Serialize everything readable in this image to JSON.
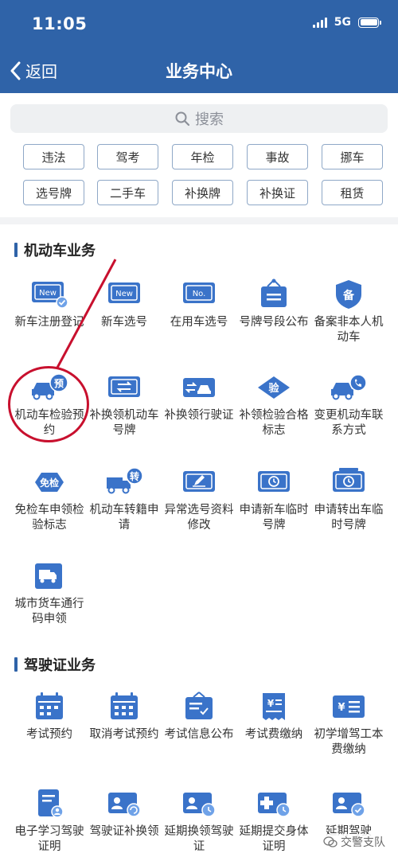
{
  "status_bar": {
    "time": "11:05",
    "network": "5G"
  },
  "nav": {
    "back_label": "返回",
    "title": "业务中心"
  },
  "search": {
    "placeholder": "搜索"
  },
  "tags": [
    "违法",
    "驾考",
    "年检",
    "事故",
    "挪车",
    "选号牌",
    "二手车",
    "补换牌",
    "补换证",
    "租赁"
  ],
  "vehicle_section": {
    "title": "机动车业务",
    "items": [
      {
        "label": "新车注册登记",
        "icon": "new-plate-check-icon"
      },
      {
        "label": "新车选号",
        "icon": "new-plate-icon"
      },
      {
        "label": "在用车选号",
        "icon": "number-plate-icon"
      },
      {
        "label": "号牌号段公布",
        "icon": "hanging-sign-icon"
      },
      {
        "label": "备案非本人机动车",
        "icon": "shield-record-icon"
      },
      {
        "label": "机动车检验预约",
        "icon": "car-reserve-icon"
      },
      {
        "label": "补换领机动车号牌",
        "icon": "plate-swap-icon"
      },
      {
        "label": "补换领行驶证",
        "icon": "license-swap-icon"
      },
      {
        "label": "补领检验合格标志",
        "icon": "inspection-badge-icon"
      },
      {
        "label": "变更机动车联系方式",
        "icon": "car-phone-icon"
      },
      {
        "label": "免检车申领检验标志",
        "icon": "exempt-badge-icon"
      },
      {
        "label": "机动车转籍申请",
        "icon": "transfer-truck-icon"
      },
      {
        "label": "异常选号资料修改",
        "icon": "edit-plate-icon"
      },
      {
        "label": "申请新车临时号牌",
        "icon": "temp-plate-icon"
      },
      {
        "label": "申请转出车临时号牌",
        "icon": "temp-plate-out-icon"
      },
      {
        "label": "城市货车通行码申领",
        "icon": "truck-pass-icon"
      }
    ]
  },
  "license_section": {
    "title": "驾驶证业务",
    "items": [
      {
        "label": "考试预约",
        "icon": "calendar-icon"
      },
      {
        "label": "取消考试预约",
        "icon": "calendar-cancel-icon"
      },
      {
        "label": "考试信息公布",
        "icon": "info-board-icon"
      },
      {
        "label": "考试费缴纳",
        "icon": "fee-receipt-icon"
      },
      {
        "label": "初学增驾工本费缴纳",
        "icon": "fee-card-icon"
      },
      {
        "label": "电子学习驾驶证明",
        "icon": "document-user-icon"
      },
      {
        "label": "驾驶证补换领",
        "icon": "license-refresh-icon"
      },
      {
        "label": "延期换领驾驶证",
        "icon": "license-clock-icon"
      },
      {
        "label": "延期提交身体证明",
        "icon": "medical-clock-icon"
      },
      {
        "label": "延期驾驶",
        "icon": "license-check-icon"
      }
    ]
  },
  "watermark": "交警支队",
  "colors": {
    "primary": "#2f63a8",
    "icon_blue": "#3a73c9",
    "highlight_red": "#c8102e"
  }
}
